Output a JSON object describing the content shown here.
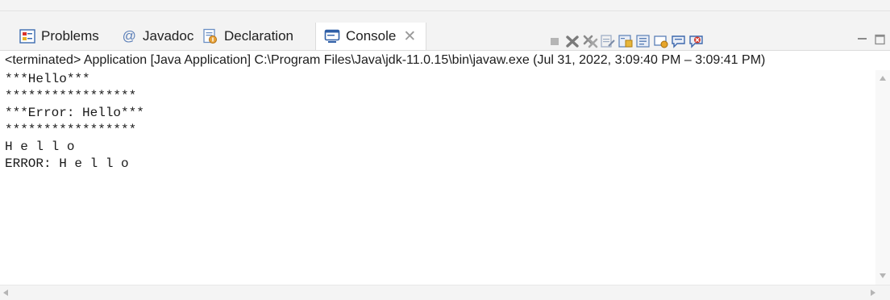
{
  "tabs": [
    {
      "label": "Problems",
      "icon": "problems-icon",
      "active": false
    },
    {
      "label": "Javadoc",
      "icon": "javadoc-at-icon",
      "active": false
    },
    {
      "label": "Declaration",
      "icon": "declaration-icon",
      "active": false
    },
    {
      "label": "Console",
      "icon": "console-icon",
      "active": true
    }
  ],
  "javadoc_glyph": "@",
  "close_glyph": "✕",
  "status_line": "<terminated> Application [Java Application] C:\\Program Files\\Java\\jdk-11.0.15\\bin\\javaw.exe  (Jul 31, 2022, 3:09:40 PM – 3:09:41 PM)",
  "console_lines": [
    "***Hello***",
    "*****************",
    "***Error: Hello***",
    "*****************",
    "H e l l o",
    "ERROR: H e l l o"
  ],
  "colors": {
    "tab_bar": "#f3f3f3",
    "console_bg": "#ffffff",
    "console_text": "#1a1a1a",
    "close_red": "#c0392b"
  }
}
